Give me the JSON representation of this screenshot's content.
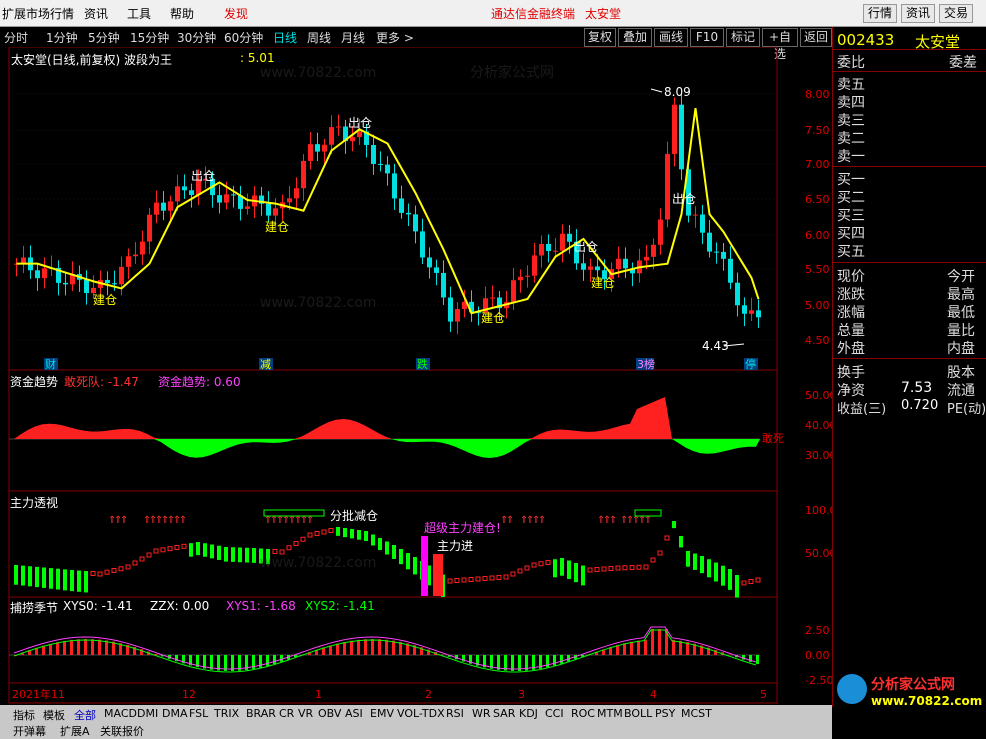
{
  "menubar": {
    "left_items": [
      "扩展市场行情",
      "资讯",
      "工具",
      "帮助",
      "发现"
    ],
    "center_text": "通达信金融终端",
    "stock_name_top": "太安堂",
    "right_buttons": [
      "行情",
      "资讯",
      "交易"
    ]
  },
  "period_tabs": [
    "分时",
    "1分钟",
    "5分钟",
    "15分钟",
    "30分钟",
    "60分钟",
    "日线",
    "周线",
    "月线",
    "更多 >"
  ],
  "toolbar_buttons": [
    "复权",
    "叠加",
    "画线",
    "F10",
    "标记",
    "+自选",
    "返回"
  ],
  "chart_title": "太安堂(日线,前复权) 波段为王",
  "chart_title_value": ": 5.01",
  "annotations": {
    "jc1": "建仓",
    "jc2": "建仓",
    "jc3": "建仓",
    "jc4": "建仓",
    "cc1": "出仓",
    "cc2": "出仓",
    "cc3": "出仓",
    "cc4": "出仓",
    "high": "8.09",
    "low": "4.43"
  },
  "price_axis": [
    "8.00",
    "7.50",
    "7.00",
    "6.50",
    "6.00",
    "5.50",
    "5.00",
    "4.50"
  ],
  "event_markers": [
    "财",
    "减",
    "跌",
    "3榜",
    "停"
  ],
  "panel2": {
    "title": "资金趋势",
    "l1": "敢死队: -1.47",
    "l2": "资金趋势: 0.60",
    "axis": [
      "50.00",
      "40.00",
      "30.00"
    ],
    "side": "敢死"
  },
  "panel3": {
    "title": "主力透视",
    "notes": [
      "分批减仓",
      "超级主力建仓!",
      "主力进"
    ],
    "axis": [
      "100.0",
      "50.00"
    ]
  },
  "panel4": {
    "title": "捕捞季节",
    "v1": "XYS0: -1.41",
    "v2": "ZZX: 0.00",
    "v3": "XYS1: -1.68",
    "v4": "XYS2: -1.41",
    "axis": [
      "2.50",
      "0.00",
      "-2.50"
    ]
  },
  "date_axis": [
    "2021年11",
    "12",
    "1",
    "2",
    "3",
    "4",
    "5"
  ],
  "indicator_tabs": [
    "指标",
    "模板",
    "全部",
    "MACD",
    "DMI",
    "DMA",
    "FSL",
    "TRIX",
    "BRAR",
    "CR",
    "VR",
    "OBV",
    "ASI",
    "EMV",
    "VOL-TDX",
    "RSI",
    "WR",
    "SAR",
    "KDJ",
    "CCI",
    "ROC",
    "MTM",
    "BOLL",
    "PSY",
    "MCST"
  ],
  "bottom_tabs2": [
    "开弹幕",
    "扩展A",
    "关联报价"
  ],
  "quote": {
    "code": "002433",
    "name": "太安堂",
    "r1": [
      "委比",
      "委差"
    ],
    "sell": [
      "卖五",
      "卖四",
      "卖三",
      "卖二",
      "卖一"
    ],
    "buy": [
      "买一",
      "买二",
      "买三",
      "买四",
      "买五"
    ],
    "left": [
      "现价",
      "涨跌",
      "涨幅",
      "总量",
      "外盘",
      "换手",
      "净资",
      "收益(三)"
    ],
    "right": [
      "今开",
      "最高",
      "最低",
      "量比",
      "内盘",
      "股本",
      "流通",
      "PE(动)"
    ],
    "jingzi_val": "7.53",
    "shouyi_val": "0.720"
  },
  "watermark": "分析家公式网",
  "watermark_url": "www.70822.com",
  "colors": {
    "up": "#ff2020",
    "down": "#00e0e0",
    "ma": "#ffff00",
    "green": "#00ff00"
  }
}
